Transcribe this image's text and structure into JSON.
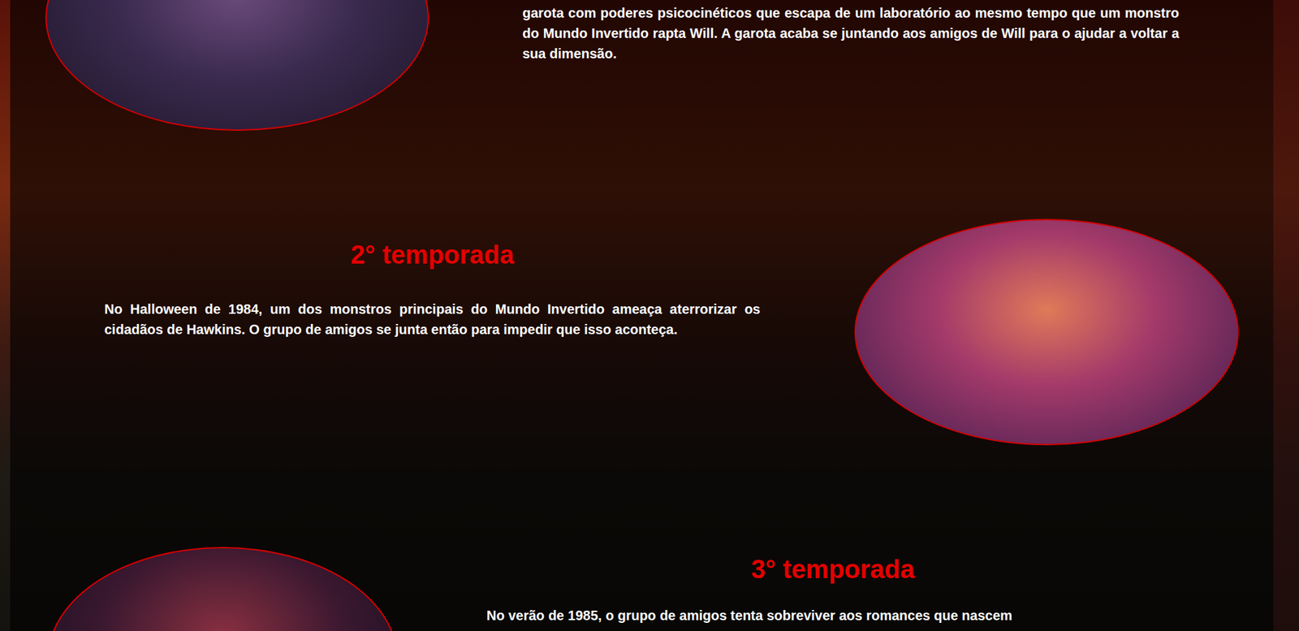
{
  "seasons": [
    {
      "title": "",
      "description": "garota com poderes psicocinéticos que escapa de um laboratório ao mesmo tempo que um monstro do Mundo Invertido rapta Will. A garota acaba se juntando aos amigos de Will para o ajudar a voltar a sua dimensão."
    },
    {
      "title": "2° temporada",
      "description": "No Halloween de 1984, um dos monstros principais do Mundo Invertido ameaça aterrorizar os cidadãos de Hawkins. O grupo de amigos se junta então para impedir que isso aconteça."
    },
    {
      "title": "3° temporada",
      "description": "No verão de 1985, o grupo de amigos tenta sobreviver aos romances que nascem"
    }
  ]
}
